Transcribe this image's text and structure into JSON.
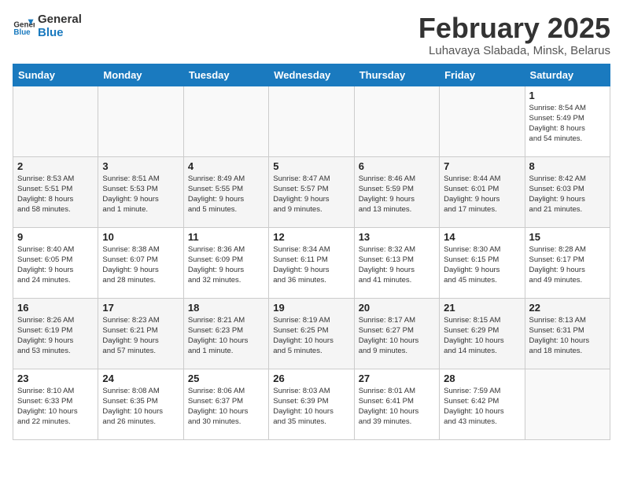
{
  "logo": {
    "line1": "General",
    "line2": "Blue"
  },
  "title": "February 2025",
  "subtitle": "Luhavaya Slabada, Minsk, Belarus",
  "headers": [
    "Sunday",
    "Monday",
    "Tuesday",
    "Wednesday",
    "Thursday",
    "Friday",
    "Saturday"
  ],
  "weeks": [
    [
      {
        "day": "",
        "info": ""
      },
      {
        "day": "",
        "info": ""
      },
      {
        "day": "",
        "info": ""
      },
      {
        "day": "",
        "info": ""
      },
      {
        "day": "",
        "info": ""
      },
      {
        "day": "",
        "info": ""
      },
      {
        "day": "1",
        "info": "Sunrise: 8:54 AM\nSunset: 5:49 PM\nDaylight: 8 hours\nand 54 minutes."
      }
    ],
    [
      {
        "day": "2",
        "info": "Sunrise: 8:53 AM\nSunset: 5:51 PM\nDaylight: 8 hours\nand 58 minutes."
      },
      {
        "day": "3",
        "info": "Sunrise: 8:51 AM\nSunset: 5:53 PM\nDaylight: 9 hours\nand 1 minute."
      },
      {
        "day": "4",
        "info": "Sunrise: 8:49 AM\nSunset: 5:55 PM\nDaylight: 9 hours\nand 5 minutes."
      },
      {
        "day": "5",
        "info": "Sunrise: 8:47 AM\nSunset: 5:57 PM\nDaylight: 9 hours\nand 9 minutes."
      },
      {
        "day": "6",
        "info": "Sunrise: 8:46 AM\nSunset: 5:59 PM\nDaylight: 9 hours\nand 13 minutes."
      },
      {
        "day": "7",
        "info": "Sunrise: 8:44 AM\nSunset: 6:01 PM\nDaylight: 9 hours\nand 17 minutes."
      },
      {
        "day": "8",
        "info": "Sunrise: 8:42 AM\nSunset: 6:03 PM\nDaylight: 9 hours\nand 21 minutes."
      }
    ],
    [
      {
        "day": "9",
        "info": "Sunrise: 8:40 AM\nSunset: 6:05 PM\nDaylight: 9 hours\nand 24 minutes."
      },
      {
        "day": "10",
        "info": "Sunrise: 8:38 AM\nSunset: 6:07 PM\nDaylight: 9 hours\nand 28 minutes."
      },
      {
        "day": "11",
        "info": "Sunrise: 8:36 AM\nSunset: 6:09 PM\nDaylight: 9 hours\nand 32 minutes."
      },
      {
        "day": "12",
        "info": "Sunrise: 8:34 AM\nSunset: 6:11 PM\nDaylight: 9 hours\nand 36 minutes."
      },
      {
        "day": "13",
        "info": "Sunrise: 8:32 AM\nSunset: 6:13 PM\nDaylight: 9 hours\nand 41 minutes."
      },
      {
        "day": "14",
        "info": "Sunrise: 8:30 AM\nSunset: 6:15 PM\nDaylight: 9 hours\nand 45 minutes."
      },
      {
        "day": "15",
        "info": "Sunrise: 8:28 AM\nSunset: 6:17 PM\nDaylight: 9 hours\nand 49 minutes."
      }
    ],
    [
      {
        "day": "16",
        "info": "Sunrise: 8:26 AM\nSunset: 6:19 PM\nDaylight: 9 hours\nand 53 minutes."
      },
      {
        "day": "17",
        "info": "Sunrise: 8:23 AM\nSunset: 6:21 PM\nDaylight: 9 hours\nand 57 minutes."
      },
      {
        "day": "18",
        "info": "Sunrise: 8:21 AM\nSunset: 6:23 PM\nDaylight: 10 hours\nand 1 minute."
      },
      {
        "day": "19",
        "info": "Sunrise: 8:19 AM\nSunset: 6:25 PM\nDaylight: 10 hours\nand 5 minutes."
      },
      {
        "day": "20",
        "info": "Sunrise: 8:17 AM\nSunset: 6:27 PM\nDaylight: 10 hours\nand 9 minutes."
      },
      {
        "day": "21",
        "info": "Sunrise: 8:15 AM\nSunset: 6:29 PM\nDaylight: 10 hours\nand 14 minutes."
      },
      {
        "day": "22",
        "info": "Sunrise: 8:13 AM\nSunset: 6:31 PM\nDaylight: 10 hours\nand 18 minutes."
      }
    ],
    [
      {
        "day": "23",
        "info": "Sunrise: 8:10 AM\nSunset: 6:33 PM\nDaylight: 10 hours\nand 22 minutes."
      },
      {
        "day": "24",
        "info": "Sunrise: 8:08 AM\nSunset: 6:35 PM\nDaylight: 10 hours\nand 26 minutes."
      },
      {
        "day": "25",
        "info": "Sunrise: 8:06 AM\nSunset: 6:37 PM\nDaylight: 10 hours\nand 30 minutes."
      },
      {
        "day": "26",
        "info": "Sunrise: 8:03 AM\nSunset: 6:39 PM\nDaylight: 10 hours\nand 35 minutes."
      },
      {
        "day": "27",
        "info": "Sunrise: 8:01 AM\nSunset: 6:41 PM\nDaylight: 10 hours\nand 39 minutes."
      },
      {
        "day": "28",
        "info": "Sunrise: 7:59 AM\nSunset: 6:42 PM\nDaylight: 10 hours\nand 43 minutes."
      },
      {
        "day": "",
        "info": ""
      }
    ]
  ]
}
